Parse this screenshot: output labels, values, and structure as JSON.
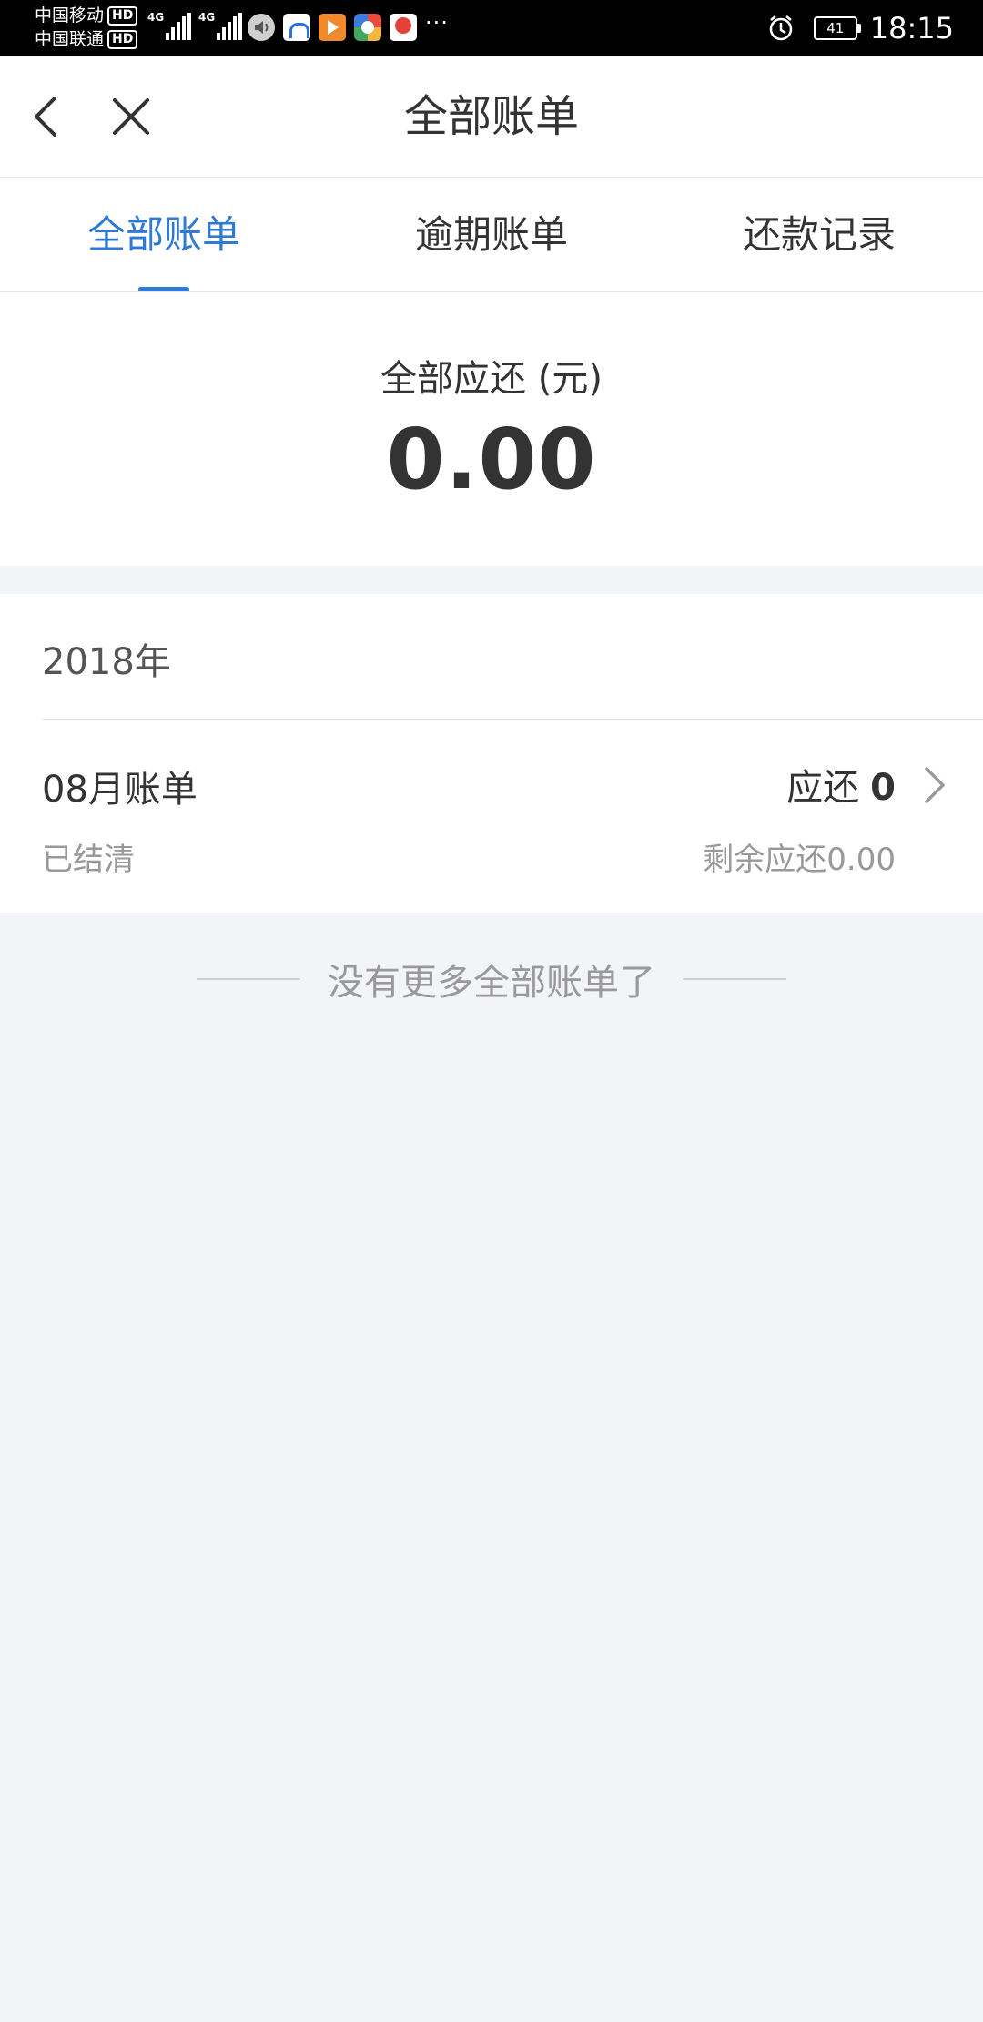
{
  "status_bar": {
    "carrier_1": "中国移动",
    "carrier_2": "中国联通",
    "hd_label": "HD",
    "network_type": "4G",
    "more_label": "···",
    "battery_level": "41",
    "time": "18:15",
    "icons": [
      "volume-icon",
      "blue-app-icon",
      "orange-play-app-icon",
      "multicolor-app-icon",
      "red-map-app-icon",
      "alarm-icon",
      "battery-icon"
    ]
  },
  "nav": {
    "title": "全部账单",
    "back_icon": "chevron-left-icon",
    "close_icon": "close-icon"
  },
  "tabs": [
    {
      "label": "全部账单",
      "active": true
    },
    {
      "label": "逾期账单",
      "active": false
    },
    {
      "label": "还款记录",
      "active": false
    }
  ],
  "summary": {
    "label": "全部应还 (元)",
    "amount": "0.00"
  },
  "bills": {
    "year": "2018年",
    "items": [
      {
        "title": "08月账单",
        "status": "已结清",
        "due_label": "应还",
        "due_value": "0",
        "remaining": "剩余应还0.00"
      }
    ]
  },
  "footer": {
    "end_text": "没有更多全部账单了"
  },
  "colors": {
    "accent": "#2f7ad6",
    "background": "#f3f4f8",
    "text_primary": "#333333",
    "text_secondary": "#999999"
  }
}
